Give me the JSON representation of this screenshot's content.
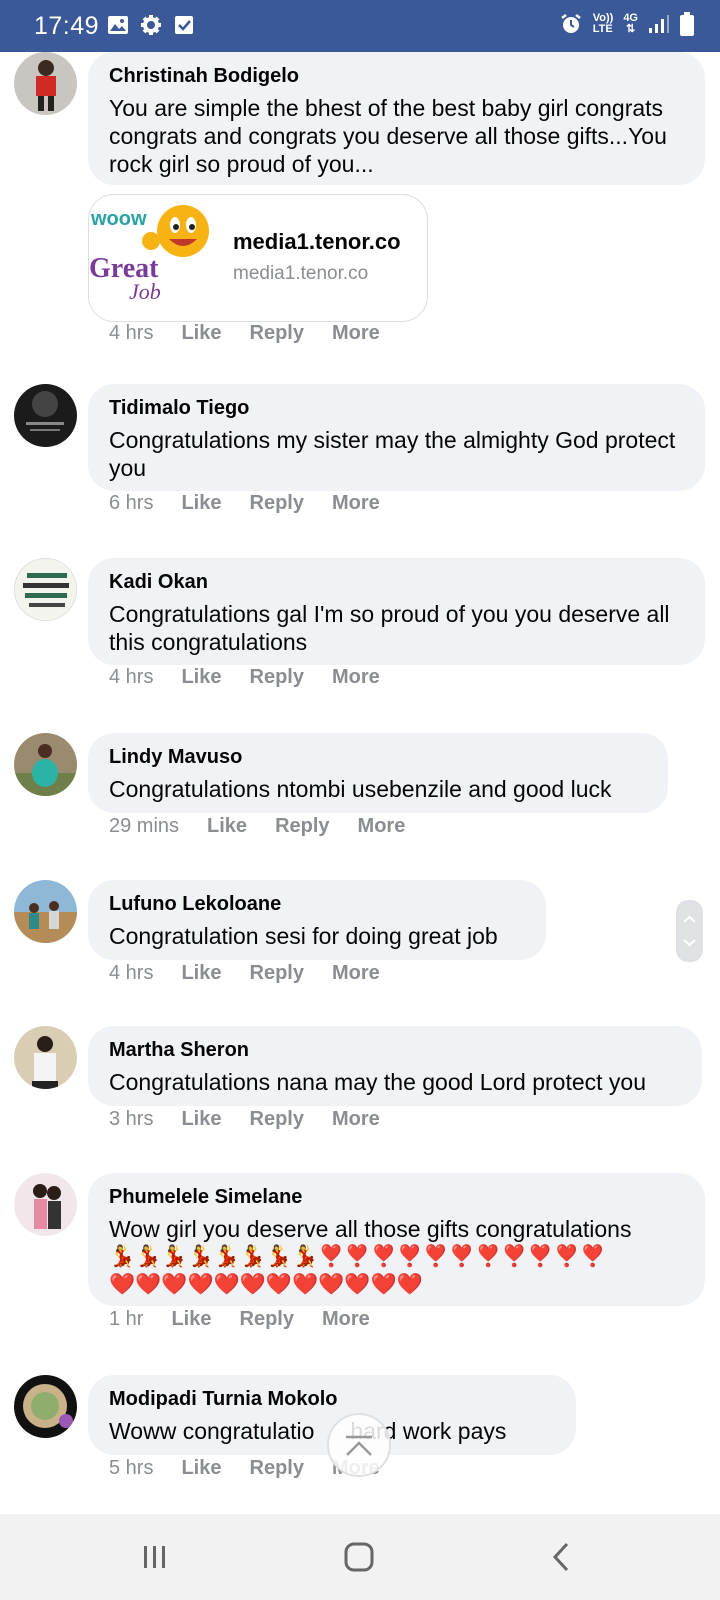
{
  "status_bar": {
    "time": "17:49",
    "left_icons": [
      "image-icon",
      "gear-icon",
      "checkbox-icon"
    ],
    "right_icons": [
      "alarm-icon",
      "volte-icon",
      "4g-icon",
      "signal-icon",
      "battery-icon"
    ],
    "volte_label_top": "Vo))",
    "volte_label_bottom": "LTE",
    "network_label": "4G"
  },
  "comments": [
    {
      "name": "Christinah Bodigelo",
      "text": "You are simple the bhest of the best baby girl congrats congrats and congrats you deserve all those gifts...You rock girl so proud of you...",
      "link": {
        "title": "media1.tenor.co",
        "domain": "media1.tenor.co",
        "gif_text_top": "woow",
        "gif_text_mid": "Great",
        "gif_text_bot": "Job"
      },
      "time": "4 hrs",
      "like": "Like",
      "reply": "Reply",
      "more": "More"
    },
    {
      "name": "Tidimalo Tiego",
      "text": "Congratulations my sister may the almighty God protect you",
      "time": "6 hrs",
      "like": "Like",
      "reply": "Reply",
      "more": "More"
    },
    {
      "name": "Kadi Okan",
      "text": "Congratulations gal I'm so proud of you you deserve all this congratulations",
      "time": "4 hrs",
      "like": "Like",
      "reply": "Reply",
      "more": "More"
    },
    {
      "name": "Lindy Mavuso",
      "text": "Congratulations ntombi usebenzile and good luck",
      "time": "29 mins",
      "like": "Like",
      "reply": "Reply",
      "more": "More"
    },
    {
      "name": "Lufuno Lekoloane",
      "text": "Congratulation sesi for doing great job",
      "time": "4 hrs",
      "like": "Like",
      "reply": "Reply",
      "more": "More"
    },
    {
      "name": "Martha Sheron",
      "text": "Congratulations nana may the good Lord protect you",
      "time": "3 hrs",
      "like": "Like",
      "reply": "Reply",
      "more": "More"
    },
    {
      "name": "Phumelele Simelane",
      "text": "Wow girl you deserve all those gifts congratulations",
      "emoji_line1": "💃💃💃💃💃💃💃💃❣️❣️❣️❣️❣️❣️❣️❣️❣️❣️❣️",
      "emoji_line2": "❤️❤️❤️❤️❤️❤️❤️❤️❤️❤️❤️❤️",
      "time": "1 hr",
      "like": "Like",
      "reply": "Reply",
      "more": "More"
    },
    {
      "name": "Modipadi Turnia Mokolo",
      "text_part1": "Woww congratulatio",
      "text_part2": "hard work pays",
      "time": "5 hrs",
      "like": "Like",
      "reply": "Reply",
      "more": "More"
    }
  ]
}
